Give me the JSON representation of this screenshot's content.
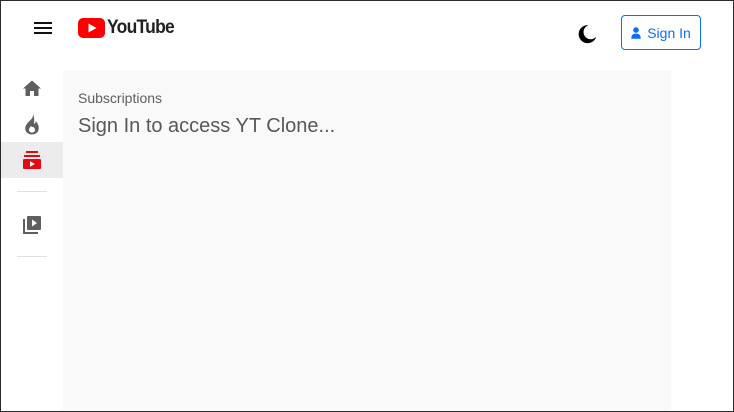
{
  "header": {
    "logo_text": "YouTube",
    "signin_label": "Sign In"
  },
  "icons": {
    "menu": "hamburger-menu-icon",
    "logo": "youtube-play-icon",
    "theme": "moon-icon",
    "user": "user-icon",
    "home": "home-icon",
    "trending": "fire-icon",
    "subscriptions": "subscriptions-icon",
    "library": "video-library-icon"
  },
  "colors": {
    "brand_red": "#ff0000",
    "active_red": "#e50914",
    "primary_blue": "#0d6efd",
    "main_bg": "#f9f9f9"
  },
  "sidebar": {
    "active_item": "subscriptions"
  },
  "main": {
    "breadcrumb": "Subscriptions",
    "message": "Sign In to access YT Clone..."
  }
}
